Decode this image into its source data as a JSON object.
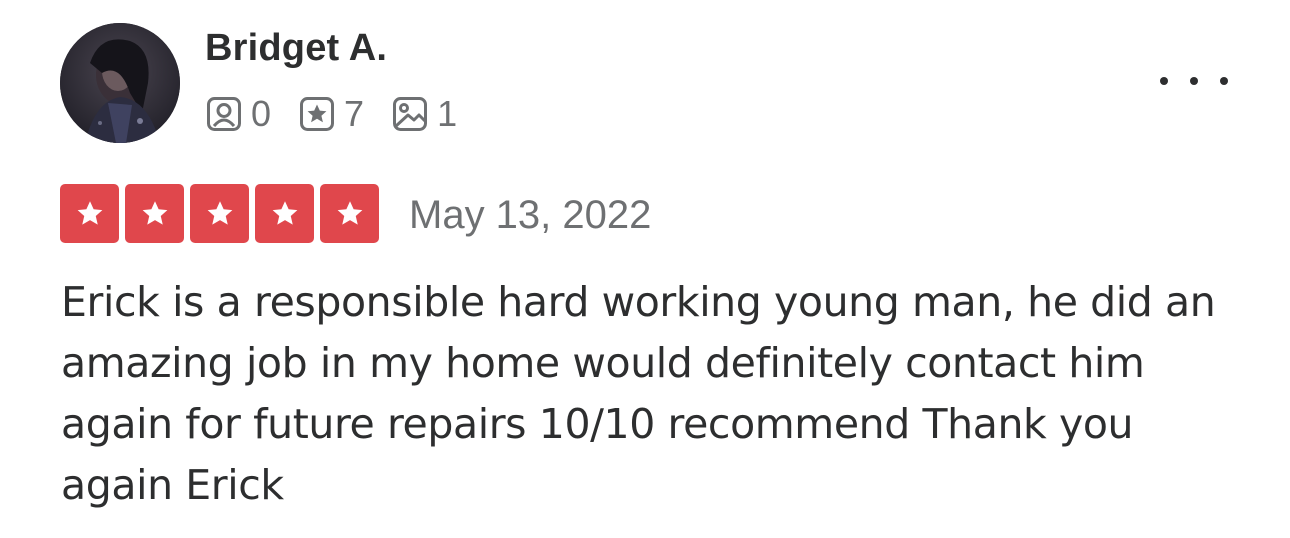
{
  "review": {
    "user": {
      "name": "Bridget A.",
      "avatar_icon": "user-photo-avatar"
    },
    "stats": [
      {
        "icon": "friends-icon",
        "count": "0"
      },
      {
        "icon": "reviews-star-icon",
        "count": "7"
      },
      {
        "icon": "photos-icon",
        "count": "1"
      }
    ],
    "more_icon": "more-options-icon",
    "rating": {
      "stars": 5,
      "max": 5,
      "color": "#e0474c"
    },
    "date": "May 13, 2022",
    "text": "Erick is a responsible hard working young man, he did an amazing job in my home would definitely contact him again for future repairs 10/10 recommend Thank you again Erick"
  }
}
